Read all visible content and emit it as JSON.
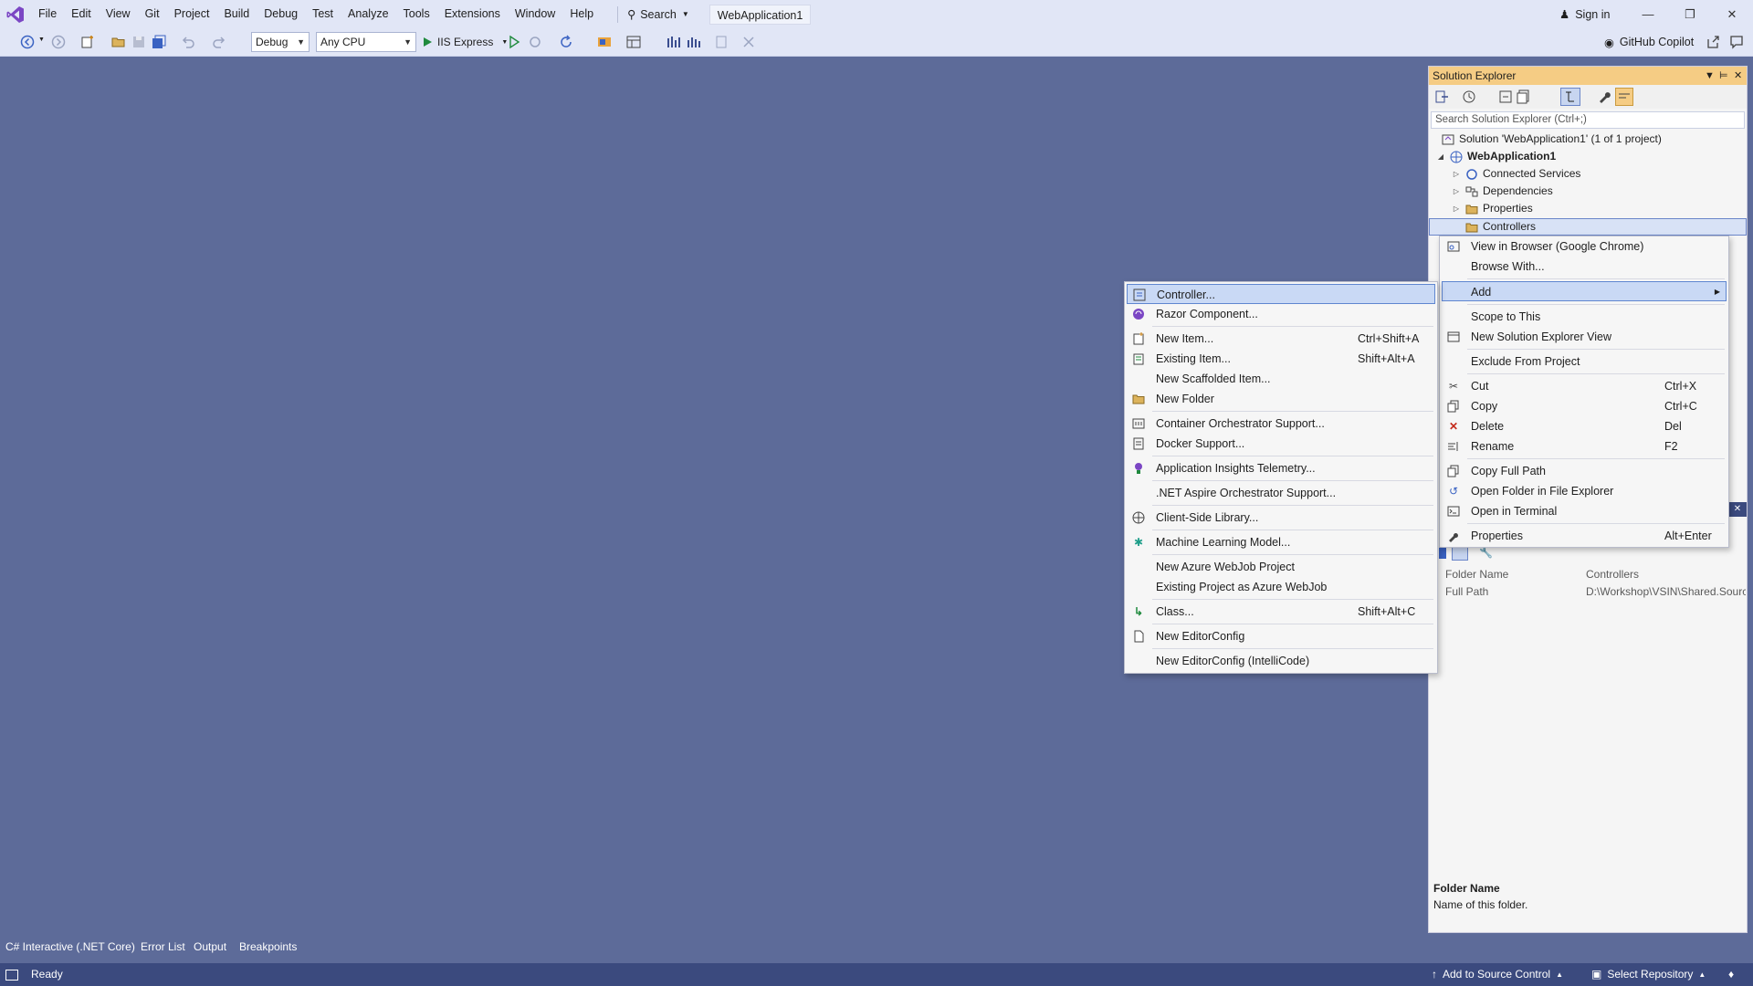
{
  "menubar": {
    "items": [
      "File",
      "Edit",
      "View",
      "Git",
      "Project",
      "Build",
      "Debug",
      "Test",
      "Analyze",
      "Tools",
      "Extensions",
      "Window",
      "Help"
    ],
    "search_label": "Search",
    "solution_name": "WebApplication1",
    "sign_in": "Sign in"
  },
  "toolbar": {
    "configuration": "Debug",
    "platform": "Any CPU",
    "run_target": "IIS Express",
    "copilot": "GitHub Copilot"
  },
  "solution_explorer": {
    "title": "Solution Explorer",
    "search_placeholder": "Search Solution Explorer (Ctrl+;)",
    "solution": "Solution 'WebApplication1' (1 of 1 project)",
    "project": "WebApplication1",
    "nodes": [
      "Connected Services",
      "Dependencies",
      "Properties",
      "Controllers"
    ]
  },
  "properties": {
    "rows": [
      {
        "name": "Folder Name",
        "value": "Controllers"
      },
      {
        "name": "Full Path",
        "value": "D:\\Workshop\\VSIN\\Shared.Sourc"
      }
    ],
    "desc_title": "Folder Name",
    "desc_text": "Name of this folder."
  },
  "context_menu": {
    "items": [
      {
        "label": "View in Browser (Google Chrome)",
        "shortcut": "",
        "icon": "browser-icon"
      },
      {
        "label": "Browse With...",
        "shortcut": "",
        "icon": ""
      },
      {
        "label": "Add",
        "shortcut": "",
        "icon": ""
      },
      {
        "label": "Scope to This",
        "shortcut": "",
        "icon": ""
      },
      {
        "label": "New Solution Explorer View",
        "shortcut": "",
        "icon": "new-view-icon"
      },
      {
        "label": "Exclude From Project",
        "shortcut": "",
        "icon": ""
      },
      {
        "label": "Cut",
        "shortcut": "Ctrl+X",
        "icon": "cut-icon"
      },
      {
        "label": "Copy",
        "shortcut": "Ctrl+C",
        "icon": "copy-icon"
      },
      {
        "label": "Delete",
        "shortcut": "Del",
        "icon": "delete-icon"
      },
      {
        "label": "Rename",
        "shortcut": "F2",
        "icon": "rename-icon"
      },
      {
        "label": "Copy Full Path",
        "shortcut": "",
        "icon": "copy-path-icon"
      },
      {
        "label": "Open Folder in File Explorer",
        "shortcut": "",
        "icon": "open-folder-icon"
      },
      {
        "label": "Open in Terminal",
        "shortcut": "",
        "icon": "terminal-icon"
      },
      {
        "label": "Properties",
        "shortcut": "Alt+Enter",
        "icon": "wrench-icon"
      }
    ]
  },
  "add_submenu": {
    "items": [
      {
        "label": "Controller...",
        "shortcut": "",
        "icon": "controller-icon"
      },
      {
        "label": "Razor Component...",
        "shortcut": "",
        "icon": "razor-icon"
      },
      {
        "label": "New Item...",
        "shortcut": "Ctrl+Shift+A",
        "icon": "new-item-icon"
      },
      {
        "label": "Existing Item...",
        "shortcut": "Shift+Alt+A",
        "icon": "existing-item-icon"
      },
      {
        "label": "New Scaffolded Item...",
        "shortcut": "",
        "icon": ""
      },
      {
        "label": "New Folder",
        "shortcut": "",
        "icon": "folder-icon"
      },
      {
        "label": "Container Orchestrator Support...",
        "shortcut": "",
        "icon": "container-icon"
      },
      {
        "label": "Docker Support...",
        "shortcut": "",
        "icon": "docker-icon"
      },
      {
        "label": "Application Insights Telemetry...",
        "shortcut": "",
        "icon": "insights-icon"
      },
      {
        "label": ".NET Aspire Orchestrator Support...",
        "shortcut": "",
        "icon": ""
      },
      {
        "label": "Client-Side Library...",
        "shortcut": "",
        "icon": "library-icon"
      },
      {
        "label": "Machine Learning Model...",
        "shortcut": "",
        "icon": "ml-icon"
      },
      {
        "label": "New Azure WebJob Project",
        "shortcut": "",
        "icon": ""
      },
      {
        "label": "Existing Project as Azure WebJob",
        "shortcut": "",
        "icon": ""
      },
      {
        "label": "Class...",
        "shortcut": "Shift+Alt+C",
        "icon": "class-icon"
      },
      {
        "label": "New EditorConfig",
        "shortcut": "",
        "icon": "editorconfig-icon"
      },
      {
        "label": "New EditorConfig (IntelliCode)",
        "shortcut": "",
        "icon": ""
      }
    ]
  },
  "bottom_tabs": [
    "C# Interactive (.NET Core)",
    "Error List",
    "Output",
    "Breakpoints"
  ],
  "statusbar": {
    "ready": "Ready",
    "source_control": "Add to Source Control",
    "repository": "Select Repository"
  }
}
